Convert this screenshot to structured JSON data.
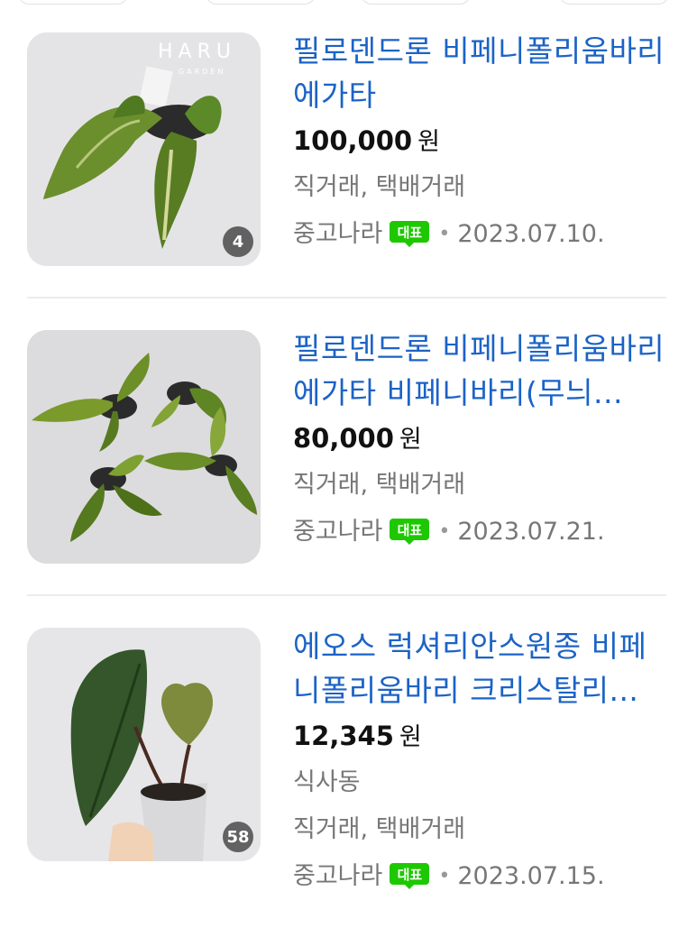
{
  "listings": [
    {
      "title": "필로덴드론 비페니폴리움바리에가타",
      "price": "100,000",
      "currency": "원",
      "location": "",
      "trade": "직거래, 택배거래",
      "source": "중고나라",
      "badge": "대표",
      "date": "2023.07.10.",
      "image_count": "4",
      "watermark": "HARU",
      "watermark_sub": "GARDEN"
    },
    {
      "title": "필로덴드론 비페니폴리움바리에가타 비페니바리(무늬...",
      "price": "80,000",
      "currency": "원",
      "location": "",
      "trade": "직거래, 택배거래",
      "source": "중고나라",
      "badge": "대표",
      "date": "2023.07.21.",
      "image_count": ""
    },
    {
      "title": "에오스 럭셔리안스원종 비페니폴리움바리 크리스탈리...",
      "price": "12,345",
      "currency": "원",
      "location": "식사동",
      "trade": "직거래, 택배거래",
      "source": "중고나라",
      "badge": "대표",
      "date": "2023.07.15.",
      "image_count": "58"
    }
  ],
  "colors": {
    "title": "#1b63c6",
    "badge_green": "#1ec800",
    "meta_gray": "#777777"
  }
}
